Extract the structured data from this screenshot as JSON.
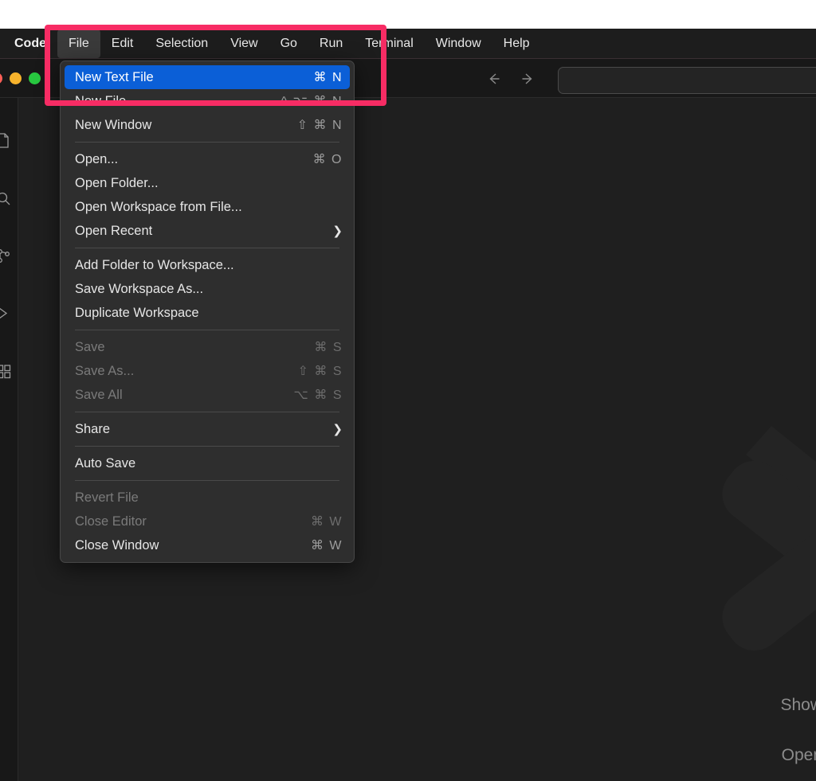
{
  "app": {
    "name": "Code",
    "menubar_items": [
      "File",
      "Edit",
      "Selection",
      "View",
      "Go",
      "Run",
      "Terminal",
      "Window",
      "Help"
    ],
    "active_menu": "File"
  },
  "titlebar": {
    "back_icon": "arrow-left-icon",
    "forward_icon": "arrow-right-icon",
    "command_center_value": "",
    "command_center_placeholder": "",
    "traffic_lights": [
      {
        "name": "minimize",
        "color": "#f7b32c"
      },
      {
        "name": "maximize",
        "color": "#28c840"
      }
    ]
  },
  "activity_bar": {
    "icons": [
      "explorer-icon",
      "search-icon",
      "source-control-icon",
      "run-debug-icon",
      "extensions-icon"
    ]
  },
  "editor": {
    "logo": "vscode-chevron-logo",
    "watermark_lines": [
      "Show",
      "Open"
    ]
  },
  "file_menu": {
    "items": [
      {
        "label": "New Text File",
        "accel": "⌘ N",
        "state": "selected",
        "submenu": false
      },
      {
        "label": "New File...",
        "accel": "^ ⌥ ⌘ N",
        "state": "enabled",
        "submenu": false
      },
      {
        "label": "New Window",
        "accel": "⇧ ⌘ N",
        "state": "enabled",
        "submenu": false
      },
      {
        "separator": true
      },
      {
        "label": "Open...",
        "accel": "⌘ O",
        "state": "enabled",
        "submenu": false
      },
      {
        "label": "Open Folder...",
        "accel": "",
        "state": "enabled",
        "submenu": false
      },
      {
        "label": "Open Workspace from File...",
        "accel": "",
        "state": "enabled",
        "submenu": false
      },
      {
        "label": "Open Recent",
        "accel": "",
        "state": "enabled",
        "submenu": true
      },
      {
        "separator": true
      },
      {
        "label": "Add Folder to Workspace...",
        "accel": "",
        "state": "enabled",
        "submenu": false
      },
      {
        "label": "Save Workspace As...",
        "accel": "",
        "state": "enabled",
        "submenu": false
      },
      {
        "label": "Duplicate Workspace",
        "accel": "",
        "state": "enabled",
        "submenu": false
      },
      {
        "separator": true
      },
      {
        "label": "Save",
        "accel": "⌘ S",
        "state": "disabled",
        "submenu": false
      },
      {
        "label": "Save As...",
        "accel": "⇧ ⌘ S",
        "state": "disabled",
        "submenu": false
      },
      {
        "label": "Save All",
        "accel": "⌥ ⌘ S",
        "state": "disabled",
        "submenu": false
      },
      {
        "separator": true
      },
      {
        "label": "Share",
        "accel": "",
        "state": "enabled",
        "submenu": true
      },
      {
        "separator": true
      },
      {
        "label": "Auto Save",
        "accel": "",
        "state": "enabled",
        "submenu": false
      },
      {
        "separator": true
      },
      {
        "label": "Revert File",
        "accel": "",
        "state": "disabled",
        "submenu": false
      },
      {
        "label": "Close Editor",
        "accel": "⌘ W",
        "state": "disabled",
        "submenu": false
      },
      {
        "label": "Close Window",
        "accel": "⌘ W",
        "state": "enabled",
        "submenu": false
      }
    ]
  },
  "annotation": {
    "name": "highlight-box",
    "color": "#f72c64"
  },
  "colors": {
    "menu_selected_bg": "#0b5fd7",
    "menu_bg": "#2e2e2e",
    "editor_bg": "#1f1f1f",
    "titlebar_bg": "#181818",
    "menubar_bg": "#1d1d1d"
  }
}
